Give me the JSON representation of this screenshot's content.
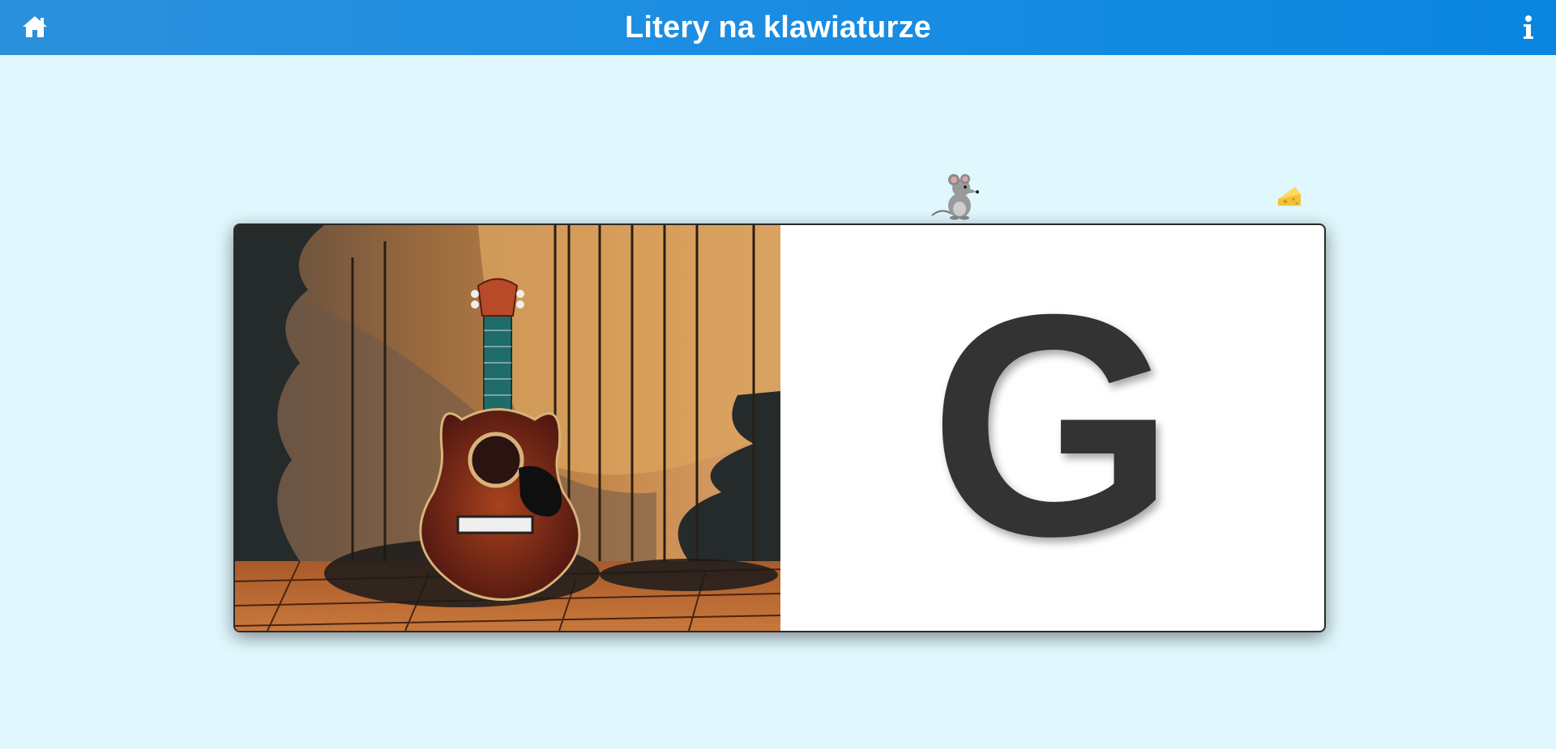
{
  "header": {
    "title": "Litery na klawiaturze",
    "home_icon": "home-icon",
    "info_icon": "info-icon",
    "background": "#1a8de2"
  },
  "card": {
    "letter": "G",
    "picture_icon": "guitar-picture",
    "letter_color": "#333333"
  },
  "progress": {
    "mouse_icon": "mouse-icon",
    "goal_icon": "cheese-icon"
  }
}
